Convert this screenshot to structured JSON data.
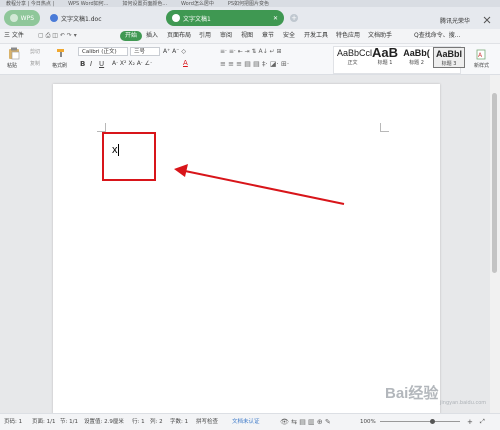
{
  "top_strip": [
    "教程分享 | 今日热点 |",
    "WPS Word如何...",
    "如何设置页面颜色...",
    "Word怎么居中",
    "PS如何把图片变色"
  ],
  "tabs": {
    "wps": "WPS",
    "doc": "文字文稿1.doc",
    "active": "文字文稿1",
    "add": "+"
  },
  "user": "腾讯光荣华",
  "menu": {
    "file": "三 文件",
    "items": [
      "开始",
      "插入",
      "页面布局",
      "引用",
      "审阅",
      "视图",
      "章节",
      "安全",
      "开发工具",
      "特色应用",
      "文档助手"
    ],
    "search": "Q查找命令、搜..."
  },
  "ribbon": {
    "paste": "粘贴",
    "cut": "剪切",
    "copy": "复制",
    "format_painter": "格式刷",
    "font_name": "Calibri (正文)",
    "font_size": "三号",
    "styles": [
      {
        "preview": "AaBbCcl",
        "label": "正文"
      },
      {
        "preview": "AaB",
        "label": "标题 1"
      },
      {
        "preview": "AaBb(",
        "label": "标题 2"
      },
      {
        "preview": "AaBbl",
        "label": "标题 3"
      }
    ],
    "new_style": "新样式"
  },
  "document": {
    "text": "x"
  },
  "status": {
    "page_no": "页码: 1",
    "pages": "页面: 1/1",
    "section": "节: 1/1",
    "setting": "设置值: 2.9厘米",
    "row": "行: 1",
    "col": "列: 2",
    "words": "字数: 1",
    "spell": "拼写检查",
    "auth": "文档未认证",
    "zoom": "100%"
  },
  "watermark": "Bai经验",
  "watermark_sub": "jingyan.baidu.com",
  "colors": {
    "accent": "#3f9852",
    "highlight_red": "#d8151a"
  }
}
